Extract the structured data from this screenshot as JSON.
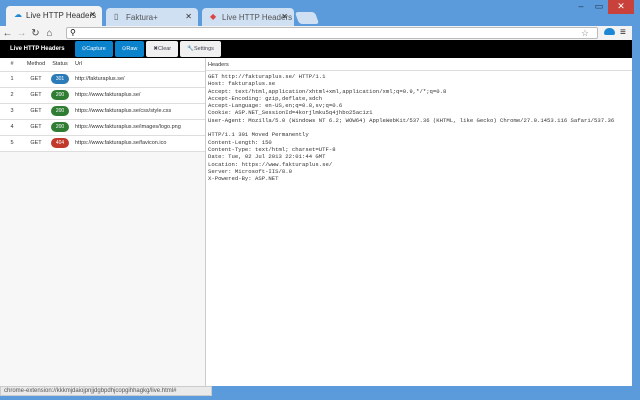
{
  "tabs": [
    {
      "label": "Live HTTP Headers",
      "active": true
    },
    {
      "label": "Faktura+",
      "active": false
    },
    {
      "label": "Live HTTP Headers - Edit",
      "active": false
    }
  ],
  "window": {
    "minimize": "–",
    "maximize": "▭",
    "close": "✕"
  },
  "omnibox": {
    "value": ""
  },
  "app": {
    "title": "Live HTTP Headers",
    "buttons": {
      "capture": "Capture",
      "raw": "Raw",
      "clear": "Clear",
      "settings": "Settings"
    }
  },
  "table": {
    "headers": [
      "#",
      "Method",
      "Status",
      "Url"
    ],
    "rows": [
      {
        "num": "1",
        "method": "GET",
        "status": "301",
        "url": "http://fakturaplus.se/",
        "color": "#2b7bb9"
      },
      {
        "num": "2",
        "method": "GET",
        "status": "200",
        "url": "https://www.fakturaplus.se/",
        "color": "#2f7d32"
      },
      {
        "num": "3",
        "method": "GET",
        "status": "200",
        "url": "https://www.fakturaplus.se/css/style.css",
        "color": "#2f7d32"
      },
      {
        "num": "4",
        "method": "GET",
        "status": "200",
        "url": "https://www.fakturaplus.se/images/logo.png",
        "color": "#2f7d32"
      },
      {
        "num": "5",
        "method": "GET",
        "status": "404",
        "url": "https://www.fakturaplus.se/favicon.ico",
        "color": "#c0392b"
      }
    ]
  },
  "headers_panel": {
    "title": "Headers",
    "text": "GET http://fakturaplus.se/ HTTP/1.1\nHost: fakturaplus.se\nAccept: text/html,application/xhtml+xml,application/xml;q=0.9,*/*;q=0.8\nAccept-Encoding: gzip,deflate,sdch\nAccept-Language: en-US,en;q=0.8,sv;q=0.6\nCookie: ASP.NET_SessionId=4korjlmku5q4jhbo25ac1z1\nUser-Agent: Mozilla/5.0 (Windows NT 6.2; WOW64) AppleWebKit/537.36 (KHTML, like Gecko) Chrome/27.0.1453.116 Safari/537.36\n\nHTTP/1.1 301 Moved Permanently\nContent-Length: 150\nContent-Type: text/html; charset=UTF-8\nDate: Tue, 02 Jul 2013 22:01:44 GMT\nLocation: https://www.fakturaplus.se/\nServer: Microsoft-IIS/8.0\nX-Powered-By: ASP.NET"
  },
  "status_bar": "chrome-extension://kkkmjdaiojpnjjdgbpdhjcopgihhagkg/live.html#"
}
